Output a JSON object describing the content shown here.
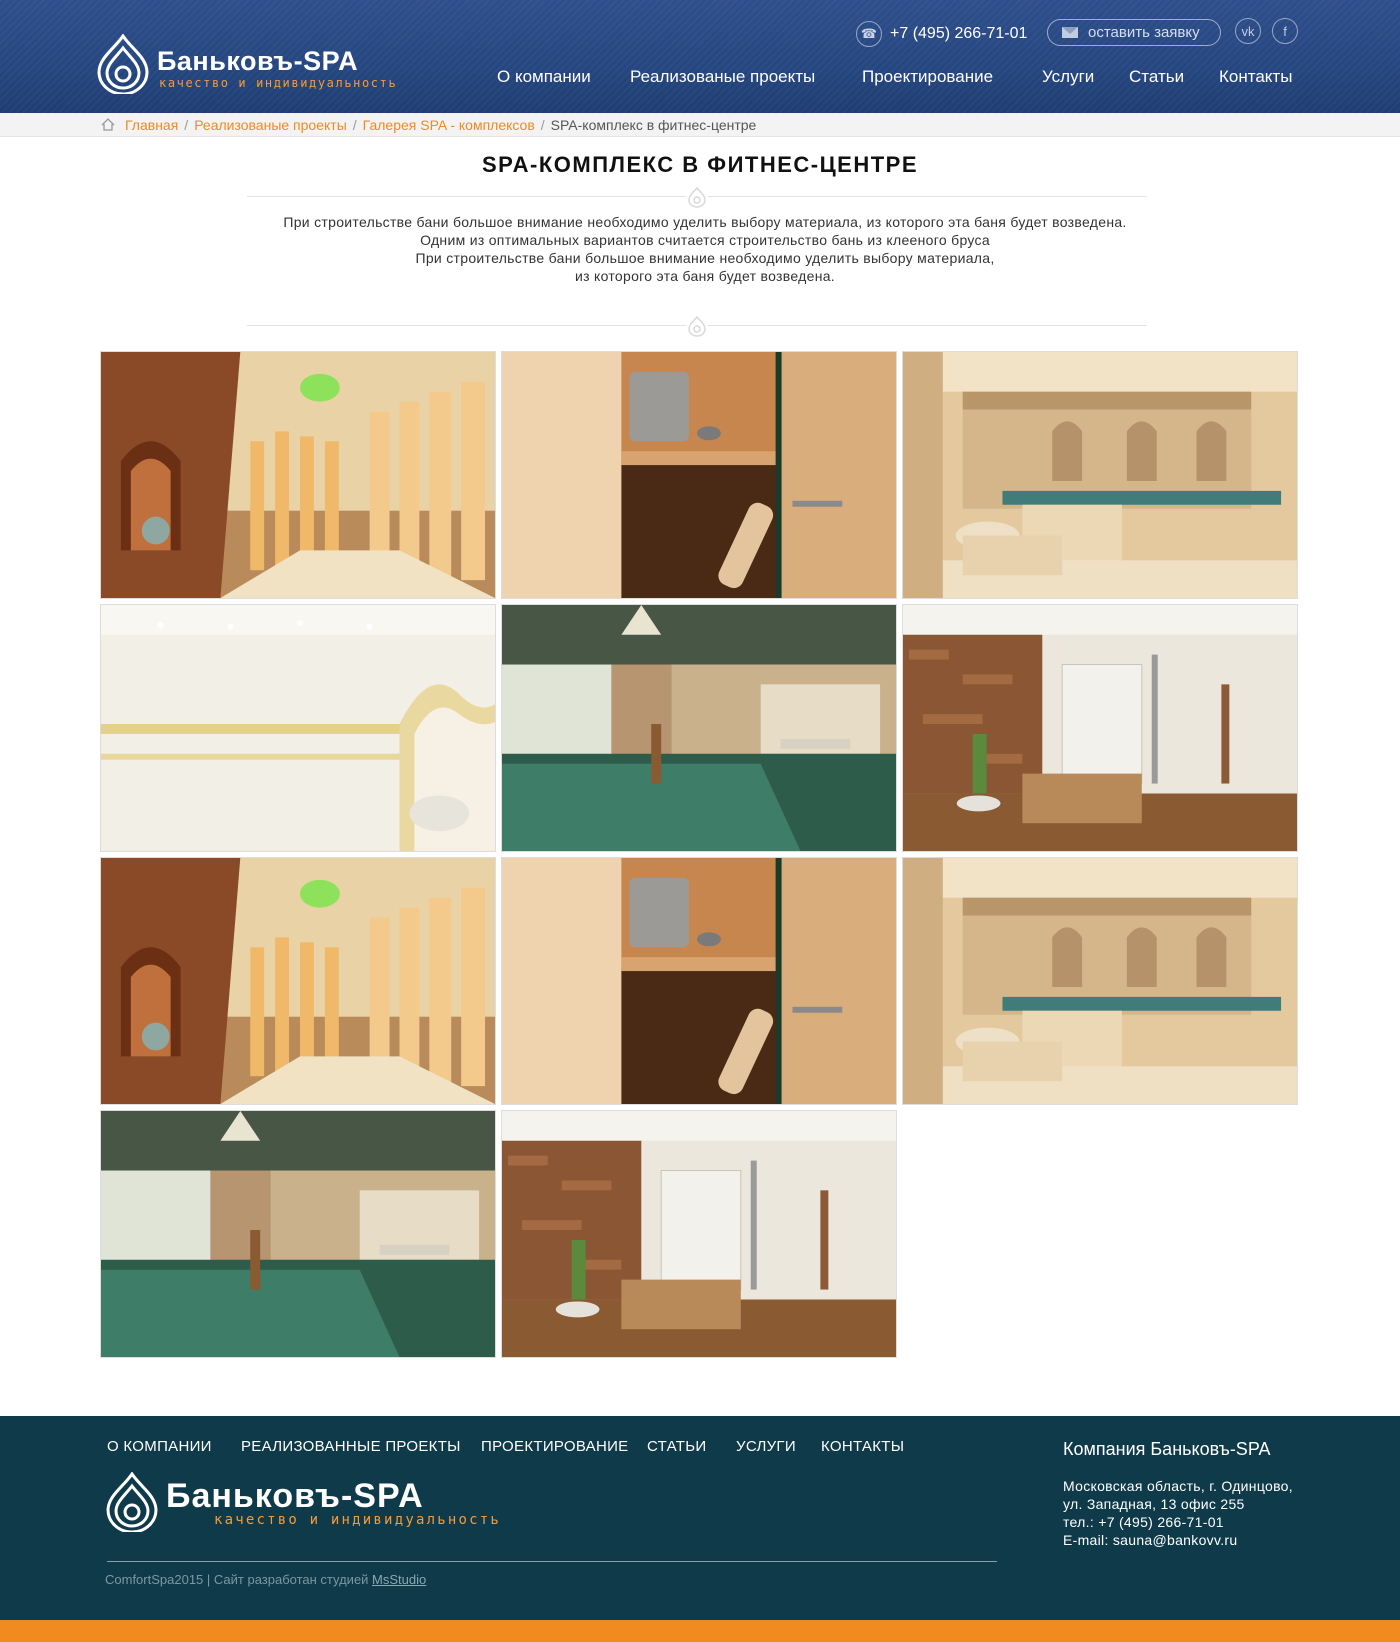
{
  "header": {
    "brand_name": "Баньковъ-SPA",
    "brand_tagline": "качество и индивидуальность",
    "phone": "+7 (495) 266-71-01",
    "request_button": "оставить заявку",
    "social": {
      "vk": "vk",
      "fb": "f"
    },
    "nav": [
      "О компании",
      "Реализованые проекты",
      "Проектирование",
      "Услуги",
      "Статьи",
      "Контакты"
    ]
  },
  "breadcrumb": {
    "items": [
      "Главная",
      "Реализованые проекты",
      "Галерея SPA - комплексов"
    ],
    "current": "SPA-комплекс в фитнес-центре"
  },
  "page": {
    "title": "SPA-КОМПЛЕКС В ФИТНЕС-ЦЕНТРЕ",
    "intro": [
      "При строительстве бани большое внимание необходимо уделить выбору материала, из которого эта баня будет возведена.",
      "Одним из оптимальных вариантов считается строительство бань из клееного бруса",
      "При строительстве бани большое внимание необходимо уделить выбору материала,",
      "из которого эта баня будет возведена."
    ]
  },
  "gallery": {
    "images": [
      "salt-cave",
      "sauna-door",
      "pool-hall",
      "hammam",
      "pool-room",
      "shower-room",
      "salt-cave",
      "sauna-door",
      "pool-hall",
      "pool-room",
      "shower-room"
    ]
  },
  "footer": {
    "nav": [
      "О КОМПАНИИ",
      "РЕАЛИЗОВАННЫЕ ПРОЕКТЫ",
      "ПРОЕКТИРОВАНИЕ",
      "СТАТЬИ",
      "УСЛУГИ",
      "КОНТАКТЫ"
    ],
    "brand_name": "Баньковъ-SPA",
    "brand_tagline": "качество и индивидуальность",
    "copyright": "ComfortSpa2015 | Сайт разработан студией ",
    "studio": "MsStudio",
    "company_title": "Компания Баньковъ-SPA",
    "address": [
      "Московская область, г. Одинцово,",
      "ул. Западная, 13 офис 255",
      "тел.: +7 (495) 266-71-01",
      "E-mail: sauna@bankovv.ru"
    ]
  },
  "colors": {
    "header_blue": "#254680",
    "accent_orange": "#f08a24",
    "footer_teal": "#0f3a4a"
  }
}
